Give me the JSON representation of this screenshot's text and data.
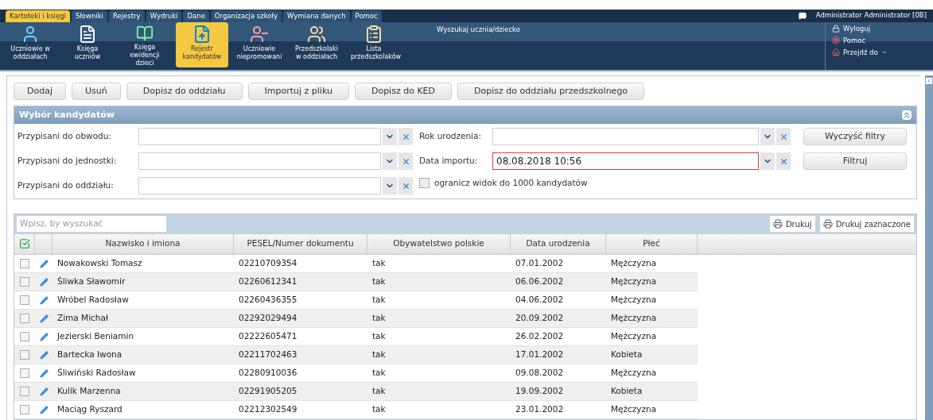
{
  "menu_tabs": [
    {
      "label": "Kartoteki i księgi",
      "selected": true
    },
    {
      "label": "Słowniki",
      "selected": false
    },
    {
      "label": "Rejestry",
      "selected": false
    },
    {
      "label": "Wydruki",
      "selected": false
    },
    {
      "label": "Dane",
      "selected": false
    },
    {
      "label": "Organizacja szkoły",
      "selected": false
    },
    {
      "label": "Wymiana danych",
      "selected": false
    },
    {
      "label": "Pomoc",
      "selected": false
    }
  ],
  "user": {
    "name": "Administrator Administrator [0B]",
    "links": [
      {
        "label": "Wyloguj",
        "kind": "logout"
      },
      {
        "label": "Pomoc",
        "kind": "help"
      },
      {
        "label": "Przejdź do",
        "kind": "goto"
      }
    ]
  },
  "toolbar": [
    {
      "label": "Uczniowie w oddziałach",
      "kind": "person",
      "selected": false
    },
    {
      "label": "Księga uczniów",
      "kind": "document",
      "selected": false
    },
    {
      "label": "Księga ewidencji dzieci",
      "kind": "book",
      "selected": false
    },
    {
      "label": "Rejestr kandydatów",
      "kind": "upload",
      "selected": true
    },
    {
      "label": "Uczniowie niepromowani",
      "kind": "person-down",
      "selected": false
    },
    {
      "label": "Przedszkolaki w oddziałach",
      "kind": "people",
      "selected": false
    },
    {
      "label": "Lista przedszkolaków",
      "kind": "people-list",
      "selected": false
    }
  ],
  "search_label": "Wyszukaj ucznia/dziecko",
  "action_buttons": [
    "Dodaj",
    "Usuń",
    "Dopisz do oddziału",
    "Importuj z pliku",
    "Dopisz do KED",
    "Dopisz do oddziału przedszkolnego"
  ],
  "filter_panel": {
    "title": "Wybór kandydatów",
    "left_fields": [
      {
        "label": "Przypisani do obwodu:"
      },
      {
        "label": "Przypisani do jednostki:"
      },
      {
        "label": "Przypisani do oddziału:"
      }
    ],
    "right_fields": [
      {
        "label": "Rok urodzenia:",
        "invalid": false
      },
      {
        "label": "Data importu:",
        "value": "08.08.2018 10:56",
        "invalid": true
      }
    ],
    "limit_checkbox": {
      "label": "ogranicz widok do 1000 kandydatów",
      "checked": false
    },
    "buttons": [
      "Wyczyść filtry",
      "Filtruj"
    ]
  },
  "grid": {
    "search_placeholder": "Wpisz, by wyszukać",
    "print_buttons": [
      "Drukuj",
      "Drukuj zaznaczone"
    ],
    "columns": [
      "Nazwisko i imiona",
      "PESEL/Numer dokumentu",
      "Obywatelstwo polskie",
      "Data urodzenia",
      "Płeć"
    ],
    "rows": [
      {
        "checked": false,
        "cells": [
          "Nowakowski Tomasz",
          "02210709354",
          "tak",
          "07.01.2002",
          "Mężczyzna"
        ]
      },
      {
        "checked": false,
        "cells": [
          "Śliwka Sławomir",
          "02260612341",
          "tak",
          "06.06.2002",
          "Mężczyzna"
        ]
      },
      {
        "checked": false,
        "cells": [
          "Wróbel Radosław",
          "02260436355",
          "tak",
          "04.06.2002",
          "Mężczyzna"
        ]
      },
      {
        "checked": false,
        "cells": [
          "Zima Michał",
          "02292029494",
          "tak",
          "20.09.2002",
          "Mężczyzna"
        ]
      },
      {
        "checked": false,
        "cells": [
          "Jezierski Beniamin",
          "02222605471",
          "tak",
          "26.02.2002",
          "Mężczyzna"
        ]
      },
      {
        "checked": false,
        "cells": [
          "Bartecka Iwona",
          "02211702463",
          "tak",
          "17.01.2002",
          "Kobieta"
        ]
      },
      {
        "checked": false,
        "cells": [
          "Śliwiński Radosław",
          "02280910036",
          "tak",
          "09.08.2002",
          "Mężczyzna"
        ]
      },
      {
        "checked": false,
        "cells": [
          "Kulik Marzenna",
          "02291905205",
          "tak",
          "19.09.2002",
          "Kobieta"
        ]
      },
      {
        "checked": false,
        "cells": [
          "Maciąg Ryszard",
          "02212302549",
          "tak",
          "23.01.2002",
          "Mężczyzna"
        ]
      }
    ]
  }
}
